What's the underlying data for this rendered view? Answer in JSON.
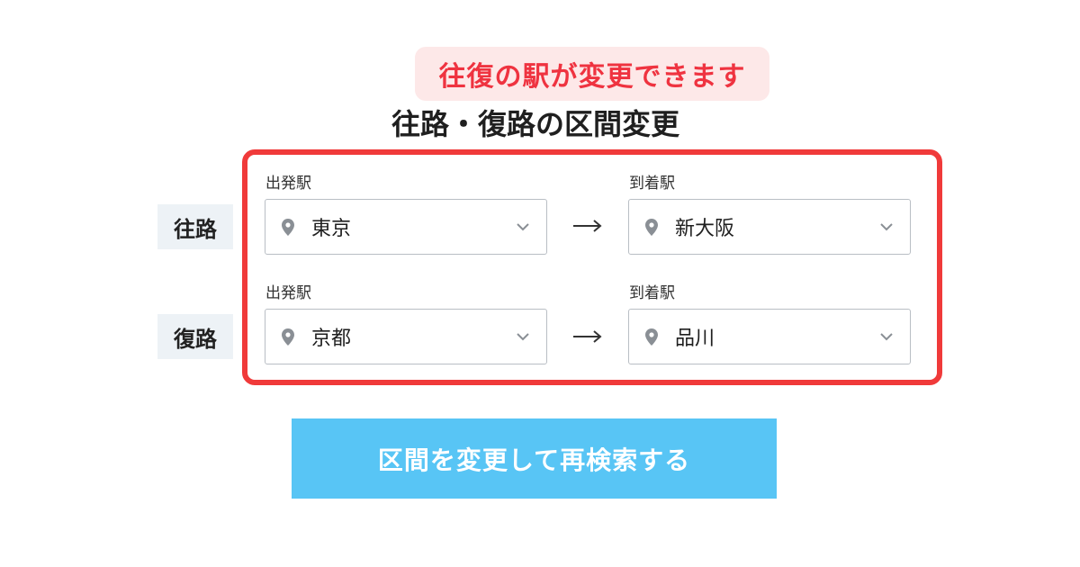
{
  "callout": {
    "text": "往復の駅が変更できます"
  },
  "section": {
    "title": "往路・復路の区間変更"
  },
  "outbound": {
    "label": "往路",
    "departure": {
      "caption": "出発駅",
      "station": "東京"
    },
    "arrival": {
      "caption": "到着駅",
      "station": "新大阪"
    }
  },
  "return": {
    "label": "復路",
    "departure": {
      "caption": "出発駅",
      "station": "京都"
    },
    "arrival": {
      "caption": "到着駅",
      "station": "品川"
    }
  },
  "submit": {
    "label": "区間を変更して再検索する"
  },
  "colors": {
    "accent_red": "#f03a3a",
    "callout_bg": "#fde8e8",
    "button_blue": "#58c5f5",
    "label_bg": "#edf2f6"
  },
  "icons": {
    "station_field": "location-pin-icon",
    "dropdown": "chevron-down-icon",
    "direction": "arrow-right-icon"
  }
}
